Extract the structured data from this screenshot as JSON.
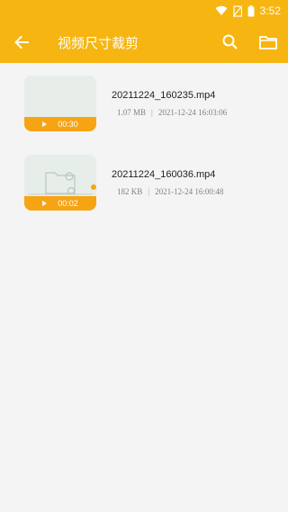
{
  "status_bar": {
    "time": "3:52",
    "icons": [
      "wifi-icon",
      "no-sim-icon",
      "battery-icon"
    ]
  },
  "app_bar": {
    "title": "视频尺寸裁剪",
    "icons": [
      "back-arrow-icon",
      "search-icon",
      "folder-icon"
    ]
  },
  "colors": {
    "accent": "#f6b511",
    "thumb_bar": "#f6a414",
    "background": "#f4f4f4"
  },
  "files": [
    {
      "name": "20211224_160235.mp4",
      "size": "1.07 MB",
      "date": "2021-12-24 16:03:06",
      "duration": "00:30"
    },
    {
      "name": "20211224_160036.mp4",
      "size": "182 KB",
      "date": "2021-12-24 16:00:48",
      "duration": "00:02"
    }
  ]
}
